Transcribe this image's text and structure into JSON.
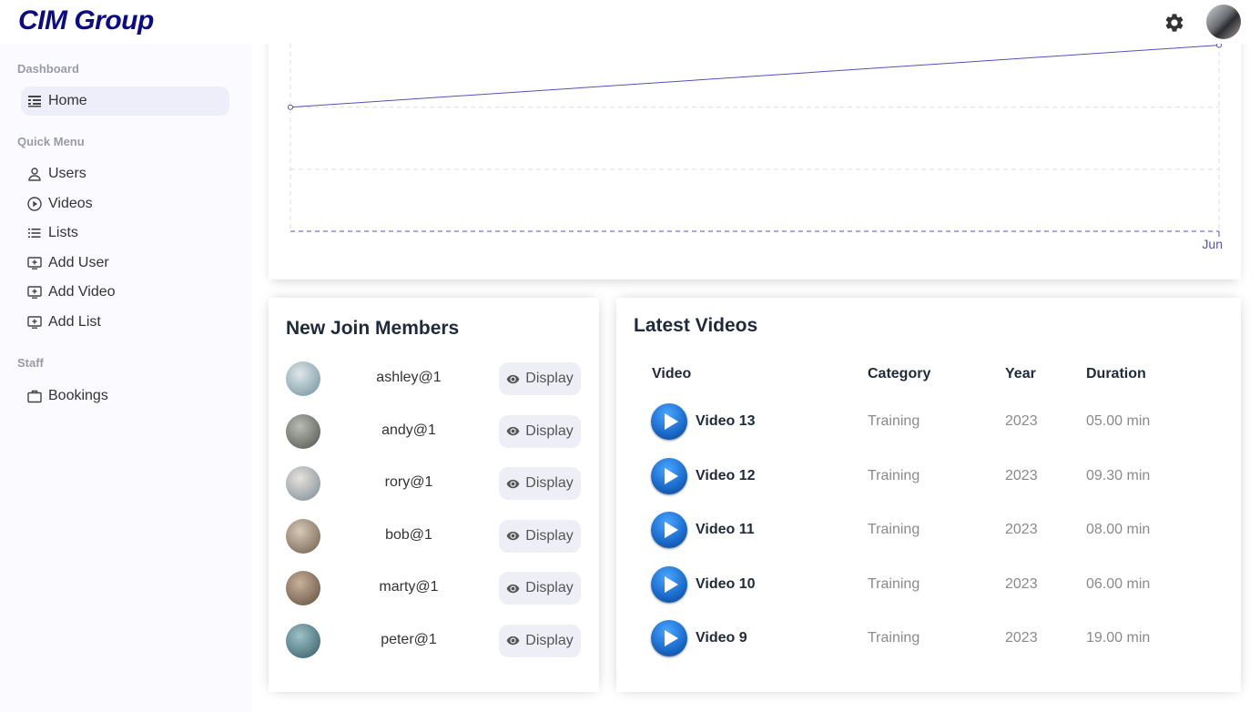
{
  "header": {
    "logo": "CIM Group"
  },
  "sidebar": {
    "sections": [
      {
        "title": "Dashboard"
      },
      {
        "title": "Quick Menu"
      },
      {
        "title": "Staff"
      }
    ],
    "items": [
      {
        "label": "Home",
        "icon": "timeline-icon"
      },
      {
        "label": "Users",
        "icon": "user-icon"
      },
      {
        "label": "Videos",
        "icon": "play-circle-icon"
      },
      {
        "label": "Lists",
        "icon": "list-icon"
      },
      {
        "label": "Add User",
        "icon": "add-to-queue-icon"
      },
      {
        "label": "Add Video",
        "icon": "add-to-queue-icon"
      },
      {
        "label": "Add List",
        "icon": "add-to-queue-icon"
      },
      {
        "label": "Bookings",
        "icon": "briefcase-icon"
      }
    ]
  },
  "chart_data": {
    "type": "line",
    "categories": [
      "",
      "Jun"
    ],
    "values": [
      1,
      1.5
    ],
    "color": "#5550bd",
    "grid": true,
    "legend": "none"
  },
  "members": {
    "title": "New Join Members",
    "button_label": "Display",
    "items": [
      {
        "name": "ashley@1"
      },
      {
        "name": "andy@1"
      },
      {
        "name": "rory@1"
      },
      {
        "name": "bob@1"
      },
      {
        "name": "marty@1"
      },
      {
        "name": "peter@1"
      }
    ]
  },
  "videos": {
    "title": "Latest Videos",
    "headers": {
      "video": "Video",
      "category": "Category",
      "year": "Year",
      "duration": "Duration"
    },
    "rows": [
      {
        "title": "Video 13",
        "category": "Training",
        "year": "2023",
        "duration": "05.00 min"
      },
      {
        "title": "Video 12",
        "category": "Training",
        "year": "2023",
        "duration": "09.30 min"
      },
      {
        "title": "Video 11",
        "category": "Training",
        "year": "2023",
        "duration": "08.00 min"
      },
      {
        "title": "Video 10",
        "category": "Training",
        "year": "2023",
        "duration": "06.00 min"
      },
      {
        "title": "Video 9",
        "category": "Training",
        "year": "2023",
        "duration": "19.00 min"
      }
    ]
  },
  "colors": {
    "accent": "#5550bd",
    "logo": "#0b0b8a",
    "active_bg": "#eeeefb",
    "button_bg": "#eeeef7"
  }
}
